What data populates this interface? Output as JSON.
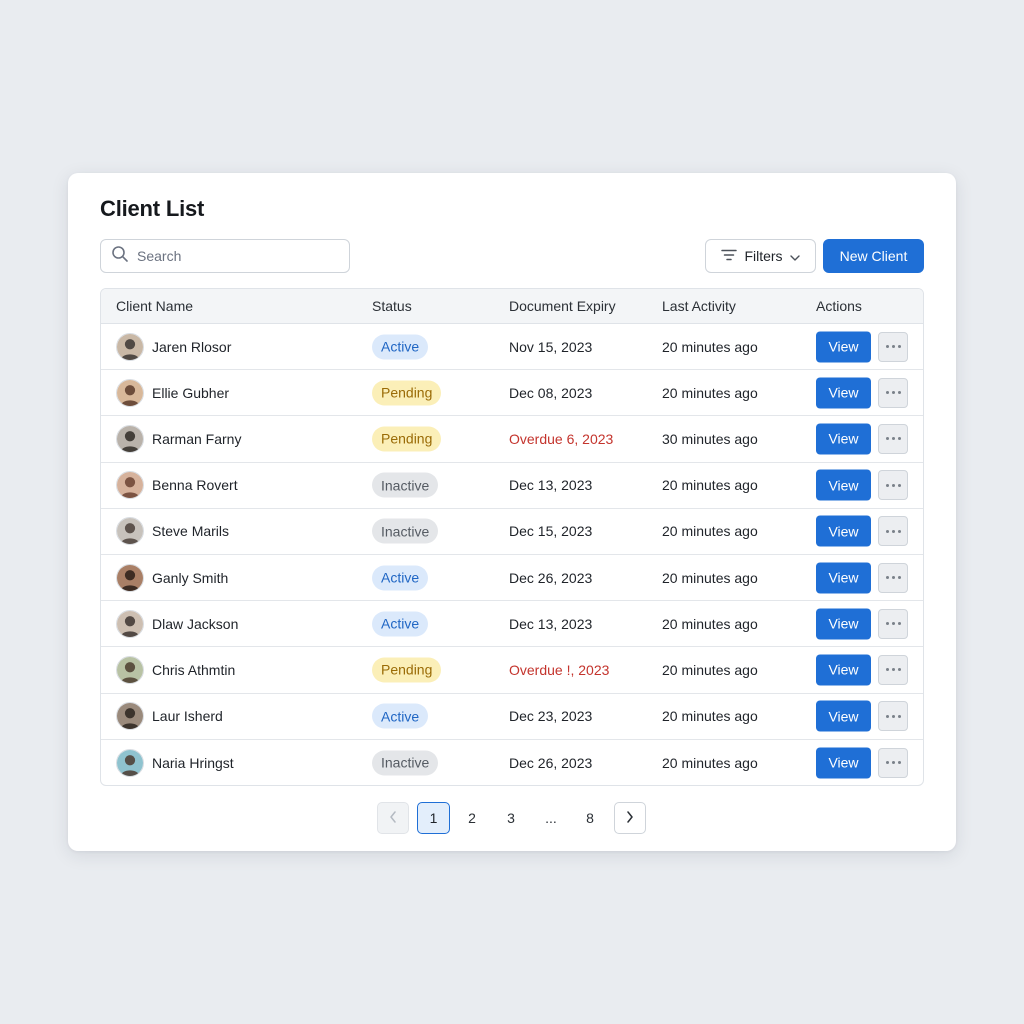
{
  "page": {
    "title": "Client List"
  },
  "toolbar": {
    "search_placeholder": "Search",
    "filters_label": "Filters",
    "new_client_label": "New Client"
  },
  "table": {
    "columns": [
      "Client Name",
      "Status",
      "Document Expiry",
      "Last Activity",
      "Actions"
    ],
    "rows": [
      {
        "name": "Jaren Rlosor",
        "status": "Active",
        "expiry": "Nov 15, 2023",
        "activity": "20 minutes ago",
        "action": "View"
      },
      {
        "name": "Ellie Gubher",
        "status": "Pending",
        "expiry": "Dec 08, 2023",
        "activity": "20 minutes ago",
        "action": "View"
      },
      {
        "name": "Rarman Farny",
        "status": "Pending",
        "expiry": "Overdue 6, 2023",
        "activity": "30 minutes ago",
        "action": "View"
      },
      {
        "name": "Benna Rovert",
        "status": "Inactive",
        "expiry": "Dec 13, 2023",
        "activity": "20 minutes ago",
        "action": "View"
      },
      {
        "name": "Steve Marils",
        "status": "Inactive",
        "expiry": "Dec 15, 2023",
        "activity": "20 minutes ago",
        "action": "View"
      },
      {
        "name": "Ganly Smith",
        "status": "Active",
        "expiry": "Dec 26, 2023",
        "activity": "20 minutes ago",
        "action": "View"
      },
      {
        "name": "Dlaw Jackson",
        "status": "Active",
        "expiry": "Dec 13, 2023",
        "activity": "20 minutes ago",
        "action": "View"
      },
      {
        "name": "Chris Athmtin",
        "status": "Pending",
        "expiry": "Overdue !, 2023",
        "activity": "20 minutes ago",
        "action": "View"
      },
      {
        "name": "Laur Isherd",
        "status": "Active",
        "expiry": "Dec 23, 2023",
        "activity": "20 minutes ago",
        "action": "View"
      },
      {
        "name": "Naria Hringst",
        "status": "Inactive",
        "expiry": "Dec 26, 2023",
        "activity": "20 minutes ago",
        "action": "View"
      }
    ]
  },
  "pagination": {
    "pages": [
      "1",
      "2",
      "3",
      "...",
      "8"
    ],
    "current": "1"
  },
  "colors": {
    "accent": "#1f6fd6",
    "active_bg": "#dbe9fb",
    "pending_bg": "#fbefb8",
    "inactive_bg": "#e4e6e9",
    "overdue": "#c4342d"
  },
  "icons": {
    "search": "search-icon",
    "filters": "filter-icon",
    "dropdown": "chevron-down-icon",
    "more": "more-horizontal-icon",
    "prev": "chevron-left-icon",
    "next": "chevron-right-icon"
  }
}
